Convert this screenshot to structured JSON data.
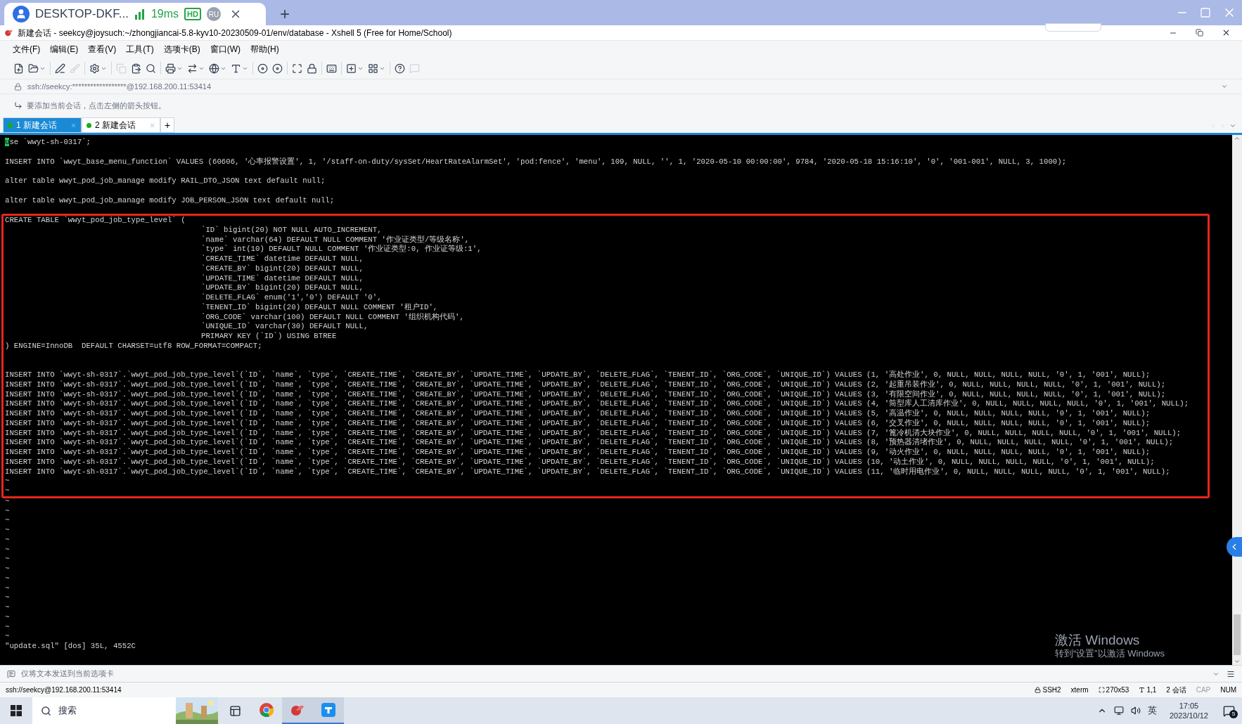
{
  "remote_bar": {
    "tab": {
      "title": "DESKTOP-DKF...",
      "latency": "19ms",
      "quality": "HD",
      "user": "RU"
    },
    "new_tab": "+"
  },
  "window": {
    "title": "新建会话 - seekcy@joysuch:~/zhongjiancai-5.8-kyv10-20230509-01/env/database - Xshell 5 (Free for Home/School)"
  },
  "menu": [
    "文件(F)",
    "编辑(E)",
    "查看(V)",
    "工具(T)",
    "选项卡(B)",
    "窗口(W)",
    "帮助(H)"
  ],
  "address": "ssh://seekcy:******************@192.168.200.11:53414",
  "hint": "要添加当前会话，点击左侧的箭头按钮。",
  "session_tabs": [
    {
      "label": "1 新建会话",
      "selected": true
    },
    {
      "label": "2 新建会话",
      "selected": false
    }
  ],
  "add_tab": "+",
  "terminal": {
    "statements": [
      "use `wwyt-sh-0317`;",
      "INSERT INTO `wwyt_base_menu_function` VALUES (60606, '心率报警设置', 1, '/staff-on-duty/sysSet/HeartRateAlarmSet', 'pod:fence', 'menu', 109, NULL, '', 1, '2020-05-10 00:00:00', 9784, '2020-05-18 15:16:10', '0', '001-001', NULL, 3, 1000);",
      "alter table wwyt_pod_job_manage modify RAIL_DTO_JSON text default null;",
      "alter table wwyt_pod_job_manage modify JOB_PERSON_JSON text default null;"
    ],
    "annotation": {
      "create_table": {
        "open": "CREATE TABLE `wwyt_pod_job_type_level` (",
        "columns": [
          "`ID` bigint(20) NOT NULL AUTO_INCREMENT,",
          "`name` varchar(64) DEFAULT NULL COMMENT '作业证类型/等级名称',",
          "`type` int(10) DEFAULT NULL COMMENT '作业证类型:0, 作业证等级:1',",
          "`CREATE_TIME` datetime DEFAULT NULL,",
          "`CREATE_BY` bigint(20) DEFAULT NULL,",
          "`UPDATE_TIME` datetime DEFAULT NULL,",
          "`UPDATE_BY` bigint(20) DEFAULT NULL,",
          "`DELETE_FLAG` enum('1','0') DEFAULT '0',",
          "`TENENT_ID` bigint(20) DEFAULT NULL COMMENT '租户ID',",
          "`ORG_CODE` varchar(100) DEFAULT NULL COMMENT '组织机构代码',",
          "`UNIQUE_ID` varchar(30) DEFAULT NULL,",
          "PRIMARY KEY (`ID`) USING BTREE"
        ],
        "close": ") ENGINE=InnoDB  DEFAULT CHARSET=utf8 ROW_FORMAT=COMPACT;"
      },
      "inserts": [
        "INSERT INTO `wwyt-sh-0317`.`wwyt_pod_job_type_level`(`ID`, `name`, `type`, `CREATE_TIME`, `CREATE_BY`, `UPDATE_TIME`, `UPDATE_BY`, `DELETE_FLAG`, `TENENT_ID`, `ORG_CODE`, `UNIQUE_ID`) VALUES (1, '高处作业', 0, NULL, NULL, NULL, NULL, '0', 1, '001', NULL);",
        "INSERT INTO `wwyt-sh-0317`.`wwyt_pod_job_type_level`(`ID`, `name`, `type`, `CREATE_TIME`, `CREATE_BY`, `UPDATE_TIME`, `UPDATE_BY`, `DELETE_FLAG`, `TENENT_ID`, `ORG_CODE`, `UNIQUE_ID`) VALUES (2, '起重吊装作业', 0, NULL, NULL, NULL, NULL, '0', 1, '001', NULL);",
        "INSERT INTO `wwyt-sh-0317`.`wwyt_pod_job_type_level`(`ID`, `name`, `type`, `CREATE_TIME`, `CREATE_BY`, `UPDATE_TIME`, `UPDATE_BY`, `DELETE_FLAG`, `TENENT_ID`, `ORG_CODE`, `UNIQUE_ID`) VALUES (3, '有限空间作业', 0, NULL, NULL, NULL, NULL, '0', 1, '001', NULL);",
        "INSERT INTO `wwyt-sh-0317`.`wwyt_pod_job_type_level`(`ID`, `name`, `type`, `CREATE_TIME`, `CREATE_BY`, `UPDATE_TIME`, `UPDATE_BY`, `DELETE_FLAG`, `TENENT_ID`, `ORG_CODE`, `UNIQUE_ID`) VALUES (4, '筒型库人工清库作业', 0, NULL, NULL, NULL, NULL, '0', 1, '001', NULL);",
        "INSERT INTO `wwyt-sh-0317`.`wwyt_pod_job_type_level`(`ID`, `name`, `type`, `CREATE_TIME`, `CREATE_BY`, `UPDATE_TIME`, `UPDATE_BY`, `DELETE_FLAG`, `TENENT_ID`, `ORG_CODE`, `UNIQUE_ID`) VALUES (5, '高温作业', 0, NULL, NULL, NULL, NULL, '0', 1, '001', NULL);",
        "INSERT INTO `wwyt-sh-0317`.`wwyt_pod_job_type_level`(`ID`, `name`, `type`, `CREATE_TIME`, `CREATE_BY`, `UPDATE_TIME`, `UPDATE_BY`, `DELETE_FLAG`, `TENENT_ID`, `ORG_CODE`, `UNIQUE_ID`) VALUES (6, '交叉作业', 0, NULL, NULL, NULL, NULL, '0', 1, '001', NULL);",
        "INSERT INTO `wwyt-sh-0317`.`wwyt_pod_job_type_level`(`ID`, `name`, `type`, `CREATE_TIME`, `CREATE_BY`, `UPDATE_TIME`, `UPDATE_BY`, `DELETE_FLAG`, `TENENT_ID`, `ORG_CODE`, `UNIQUE_ID`) VALUES (7, '篦冷机清大块作业', 0, NULL, NULL, NULL, NULL, '0', 1, '001', NULL);",
        "INSERT INTO `wwyt-sh-0317`.`wwyt_pod_job_type_level`(`ID`, `name`, `type`, `CREATE_TIME`, `CREATE_BY`, `UPDATE_TIME`, `UPDATE_BY`, `DELETE_FLAG`, `TENENT_ID`, `ORG_CODE`, `UNIQUE_ID`) VALUES (8, '预热器清堵作业', 0, NULL, NULL, NULL, NULL, '0', 1, '001', NULL);",
        "INSERT INTO `wwyt-sh-0317`.`wwyt_pod_job_type_level`(`ID`, `name`, `type`, `CREATE_TIME`, `CREATE_BY`, `UPDATE_TIME`, `UPDATE_BY`, `DELETE_FLAG`, `TENENT_ID`, `ORG_CODE`, `UNIQUE_ID`) VALUES (9, '动火作业', 0, NULL, NULL, NULL, NULL, '0', 1, '001', NULL);",
        "INSERT INTO `wwyt-sh-0317`.`wwyt_pod_job_type_level`(`ID`, `name`, `type`, `CREATE_TIME`, `CREATE_BY`, `UPDATE_TIME`, `UPDATE_BY`, `DELETE_FLAG`, `TENENT_ID`, `ORG_CODE`, `UNIQUE_ID`) VALUES (10, '动土作业', 0, NULL, NULL, NULL, NULL, '0', 1, '001', NULL);",
        "INSERT INTO `wwyt-sh-0317`.`wwyt_pod_job_type_level`(`ID`, `name`, `type`, `CREATE_TIME`, `CREATE_BY`, `UPDATE_TIME`, `UPDATE_BY`, `DELETE_FLAG`, `TENENT_ID`, `ORG_CODE`, `UNIQUE_ID`) VALUES (11, '临时用电作业', 0, NULL, NULL, NULL, NULL, '0', 1, '001', NULL);"
      ],
      "empty_lines": [
        "~",
        "~"
      ]
    },
    "empty_lines": [
      "~",
      "~",
      "~",
      "~",
      "~",
      "~",
      "~",
      "~",
      "~",
      "~",
      "~",
      "~",
      "~",
      "~",
      "~"
    ],
    "status_line": "\"update.sql\" [dos] 35L, 4552C"
  },
  "activation_notice": {
    "title": "激活 Windows",
    "text": "转到“设置”以激活 Windows"
  },
  "send_bar": {
    "placeholder": "仅将文本发送到当前选项卡"
  },
  "status_bar": {
    "connection": "ssh://seekcy@192.168.200.11:53414",
    "protocol": "SSH2",
    "terminal": "xterm",
    "size": "270x53",
    "cursor": "1,1",
    "sessions": "2 会话",
    "indicators": [
      {
        "label": "CAP",
        "on": false
      },
      {
        "label": "NUM",
        "on": true
      }
    ]
  },
  "taskbar": {
    "search": {
      "placeholder": "搜索"
    },
    "apps": [
      {
        "kind": "browser",
        "active": false
      },
      {
        "kind": "terminal",
        "active": true
      },
      {
        "kind": "remote",
        "active": true
      }
    ],
    "input_method": "英",
    "time": "17:05",
    "date": "2023/10/12",
    "notifications": "5"
  }
}
